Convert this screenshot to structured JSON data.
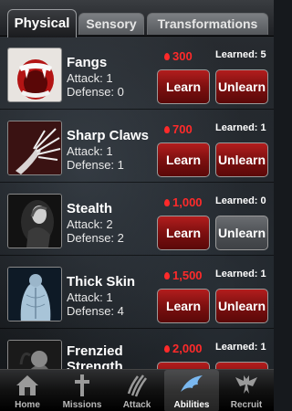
{
  "tabs": [
    {
      "label": "Physical"
    },
    {
      "label": "Sensory"
    },
    {
      "label": "Transformations"
    }
  ],
  "abilities": [
    {
      "name": "Fangs",
      "attack": "Attack: 1",
      "defense": "Defense: 0",
      "cost": "300",
      "learned": "Learned: 5",
      "learn_label": "Learn",
      "unlearn_label": "Unlearn",
      "unlearn_enabled": true,
      "image": "fangs-mouth"
    },
    {
      "name": "Sharp Claws",
      "attack": "Attack: 1",
      "defense": "Defense: 1",
      "cost": "700",
      "learned": "Learned: 1",
      "learn_label": "Learn",
      "unlearn_label": "Unlearn",
      "unlearn_enabled": true,
      "image": "clawed-hand"
    },
    {
      "name": "Stealth",
      "attack": "Attack: 2",
      "defense": "Defense: 2",
      "cost": "1,000",
      "learned": "Learned: 0",
      "learn_label": "Learn",
      "unlearn_label": "Unlearn",
      "unlearn_enabled": false,
      "image": "hooded-figure"
    },
    {
      "name": "Thick Skin",
      "attack": "Attack: 1",
      "defense": "Defense: 4",
      "cost": "1,500",
      "learned": "Learned: 1",
      "learn_label": "Learn",
      "unlearn_label": "Unlearn",
      "unlearn_enabled": true,
      "image": "muscular-back"
    },
    {
      "name": "Frenzied Strength",
      "attack": "",
      "defense": "",
      "cost": "2,000",
      "learned": "Learned: 1",
      "learn_label": "",
      "unlearn_label": "",
      "unlearn_enabled": true,
      "image": "frenzied-figure"
    }
  ],
  "tabbar": [
    {
      "label": "Home",
      "icon": "house-icon"
    },
    {
      "label": "Missions",
      "icon": "cross-icon"
    },
    {
      "label": "Attack",
      "icon": "claw-marks-icon"
    },
    {
      "label": "Abilities",
      "icon": "bat-wing-icon"
    },
    {
      "label": "Recruit",
      "icon": "bat-figure-icon"
    }
  ],
  "colors": {
    "accent_red": "#ff2a2a",
    "button_red": "#8a1212",
    "disabled_gray": "#55585c"
  }
}
